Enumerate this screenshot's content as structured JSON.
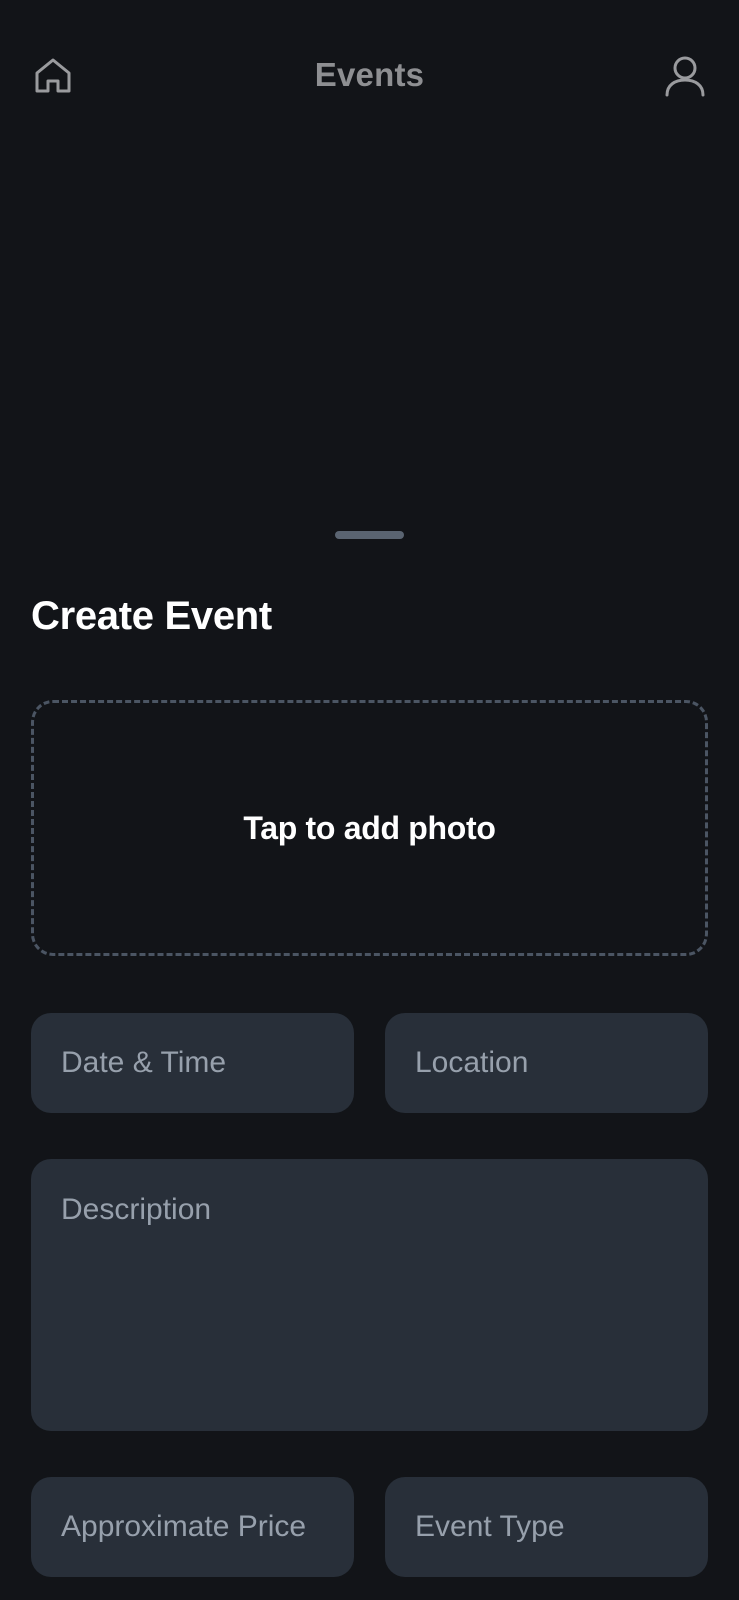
{
  "header": {
    "title": "Events",
    "left_icon": "home-icon",
    "right_icon": "user-profile-icon"
  },
  "sheet": {
    "title": "Create Event",
    "photo_prompt": "Tap to add photo",
    "fields": {
      "date_time": {
        "placeholder": "Date & Time",
        "value": ""
      },
      "location": {
        "placeholder": "Location",
        "value": ""
      },
      "description": {
        "placeholder": "Description",
        "value": ""
      },
      "price": {
        "placeholder": "Approximate Price",
        "value": ""
      },
      "event_type": {
        "placeholder": "Event Type",
        "value": ""
      }
    }
  },
  "colors": {
    "background": "#121418",
    "field_background": "#282f39",
    "placeholder_text": "#97a0ac",
    "title_text": "#8e8f92",
    "heading_text": "#ffffff",
    "dashed_border": "#4b5563"
  }
}
